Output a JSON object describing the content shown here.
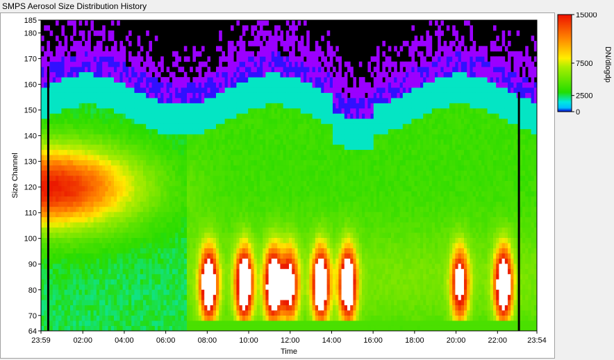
{
  "window": {
    "title": "SMPS Aerosol Size Distribution History"
  },
  "chart_data": {
    "type": "heatmap",
    "xlabel": "Time",
    "ylabel": "Size Channel",
    "x_tick_labels": [
      "23:59",
      "02:00",
      "04:00",
      "06:00",
      "08:00",
      "10:00",
      "12:00",
      "14:00",
      "16:00",
      "18:00",
      "20:00",
      "22:00",
      "23:54"
    ],
    "x_tick_hours": [
      0,
      2.017,
      4.017,
      6.017,
      8.017,
      10.017,
      12.017,
      14.017,
      16.017,
      18.017,
      20.017,
      22.017,
      23.917
    ],
    "xlim_hours": [
      0,
      23.917
    ],
    "y_ticks": [
      64,
      70,
      80,
      90,
      100,
      110,
      120,
      130,
      140,
      150,
      160,
      170,
      180,
      185
    ],
    "ylim": [
      64,
      185
    ],
    "colorbar": {
      "label": "DN/dlogdp",
      "ticks": [
        0,
        2500,
        7500,
        15000
      ],
      "tick_labels": [
        "0",
        "2500",
        "7500",
        "15000"
      ],
      "range": [
        0,
        15000
      ]
    },
    "colors": {
      "background_noise": "#000000",
      "low": "#9b00ff",
      "mid_low": "#00e0e0",
      "mid": "#22dd00",
      "high": "#ffee00",
      "peak": "#ee2000",
      "saturated": "#ffffff"
    },
    "features": {
      "nighttime_mode_peak_channel": 120,
      "nucleation_event_hours": [
        8.1,
        9.8,
        11.2,
        12.0,
        13.5,
        14.8,
        20.2,
        22.3
      ]
    }
  }
}
